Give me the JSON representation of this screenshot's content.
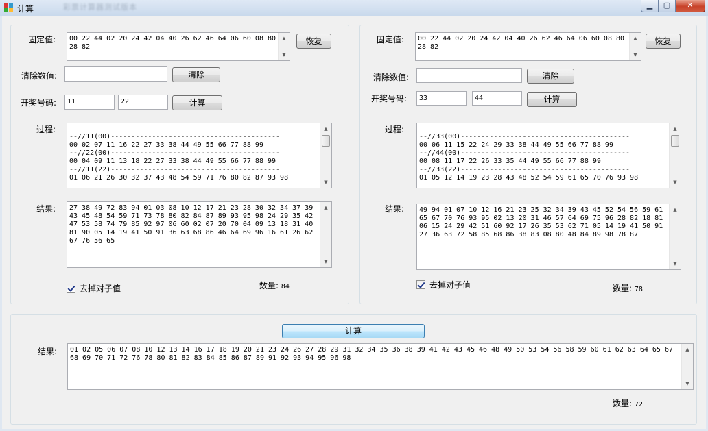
{
  "window": {
    "title": "计算",
    "blurred_title": "彩票计算器测试版本"
  },
  "left": {
    "fixed_label": "固定值:",
    "fixed_value": "00 22 44 02 20 24 42 04 40 26 62 46 64 06 60 08 80\n28 82",
    "restore_button": "恢复",
    "clear_label": "清除数值:",
    "clear_value": "",
    "clear_button": "清除",
    "lottery_label": "开奖号码:",
    "lottery_1": "11",
    "lottery_2": "22",
    "calc_button": "计算",
    "process_label": "过程:",
    "process_text": "--//11(00)-----------------------------------------\n00 02 07 11 16 22 27 33 38 44 49 55 66 77 88 99\n--//22(00)-----------------------------------------\n00 04 09 11 13 18 22 27 33 38 44 49 55 66 77 88 99\n--//11(22)-----------------------------------------\n01 06 21 26 30 32 37 43 48 54 59 71 76 80 82 87 93 98",
    "result_label": "结果:",
    "result_text": "27 38 49 72 83 94 01 03 08 10 12 17 21 23 28 30 32 34 37 39\n43 45 48 54 59 71 73 78 80 82 84 87 89 93 95 98 24 29 35 42\n47 53 58 74 79 85 92 97 06 60 02 07 20 70 04 09 13 18 31 40\n81 90 05 14 19 41 50 91 36 63 68 86 46 64 69 96 16 61 26 62\n67 76 56 65",
    "checkbox_label": "去掉对子值",
    "count_label": "数量:",
    "count_value": "84"
  },
  "right": {
    "fixed_label": "固定值:",
    "fixed_value": "00 22 44 02 20 24 42 04 40 26 62 46 64 06 60 08 80\n28 82",
    "restore_button": "恢复",
    "clear_label": "清除数值:",
    "clear_value": "",
    "clear_button": "清除",
    "lottery_label": "开奖号码:",
    "lottery_1": "33",
    "lottery_2": "44",
    "calc_button": "计算",
    "process_label": "过程:",
    "process_text": "--//33(00)-----------------------------------------\n00 06 11 15 22 24 29 33 38 44 49 55 66 77 88 99\n--//44(00)-----------------------------------------\n00 08 11 17 22 26 33 35 44 49 55 66 77 88 99\n--//33(22)-----------------------------------------\n01 05 12 14 19 23 28 43 48 52 54 59 61 65 70 76 93 98",
    "result_label": "结果:",
    "result_text": "49 94 01 07 10 12 16 21 23 25 32 34 39 43 45 52 54 56 59 61\n65 67 70 76 93 95 02 13 20 31 46 57 64 69 75 96 28 82 18 81\n06 15 24 29 42 51 60 92 17 26 35 53 62 71 05 14 19 41 50 91\n27 36 63 72 58 85 68 86 38 83 08 80 48 84 89 98 78 87",
    "checkbox_label": "去掉对子值",
    "count_label": "数量:",
    "count_value": "78"
  },
  "bottom": {
    "calc_button": "计算",
    "result_label": "结果:",
    "result_text": "01 02 05 06 07 08 10 12 13 14 16 17 18 19 20 21 23 24 26 27 28 29 31 32 34 35 36 38 39 41 42 43 45 46 48 49 50 53 54 56 58 59 60 61 62 63 64 65 67\n68 69 70 71 72 76 78 80 81 82 83 84 85 86 87 89 91 92 93 94 95 96 98",
    "count_label": "数量:",
    "count_value": "72"
  }
}
